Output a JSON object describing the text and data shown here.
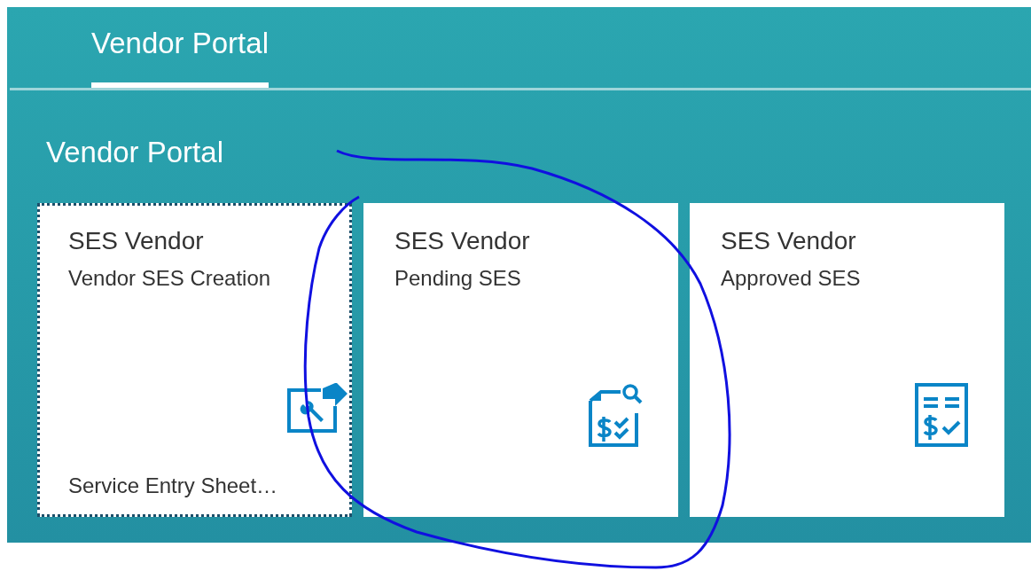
{
  "tabs": [
    {
      "label": "Vendor Portal",
      "selected": true
    }
  ],
  "group": {
    "title": "Vendor Portal",
    "tiles": [
      {
        "title": "SES Vendor",
        "subtitle": "Vendor SES Creation",
        "footer": "Service Entry Sheet…",
        "kind": "create",
        "focused": true
      },
      {
        "title": "SES Vendor",
        "subtitle": "Pending SES",
        "kind": "pending",
        "focused": false
      },
      {
        "title": "SES Vendor",
        "subtitle": "Approved SES",
        "kind": "approved",
        "focused": false
      }
    ]
  }
}
